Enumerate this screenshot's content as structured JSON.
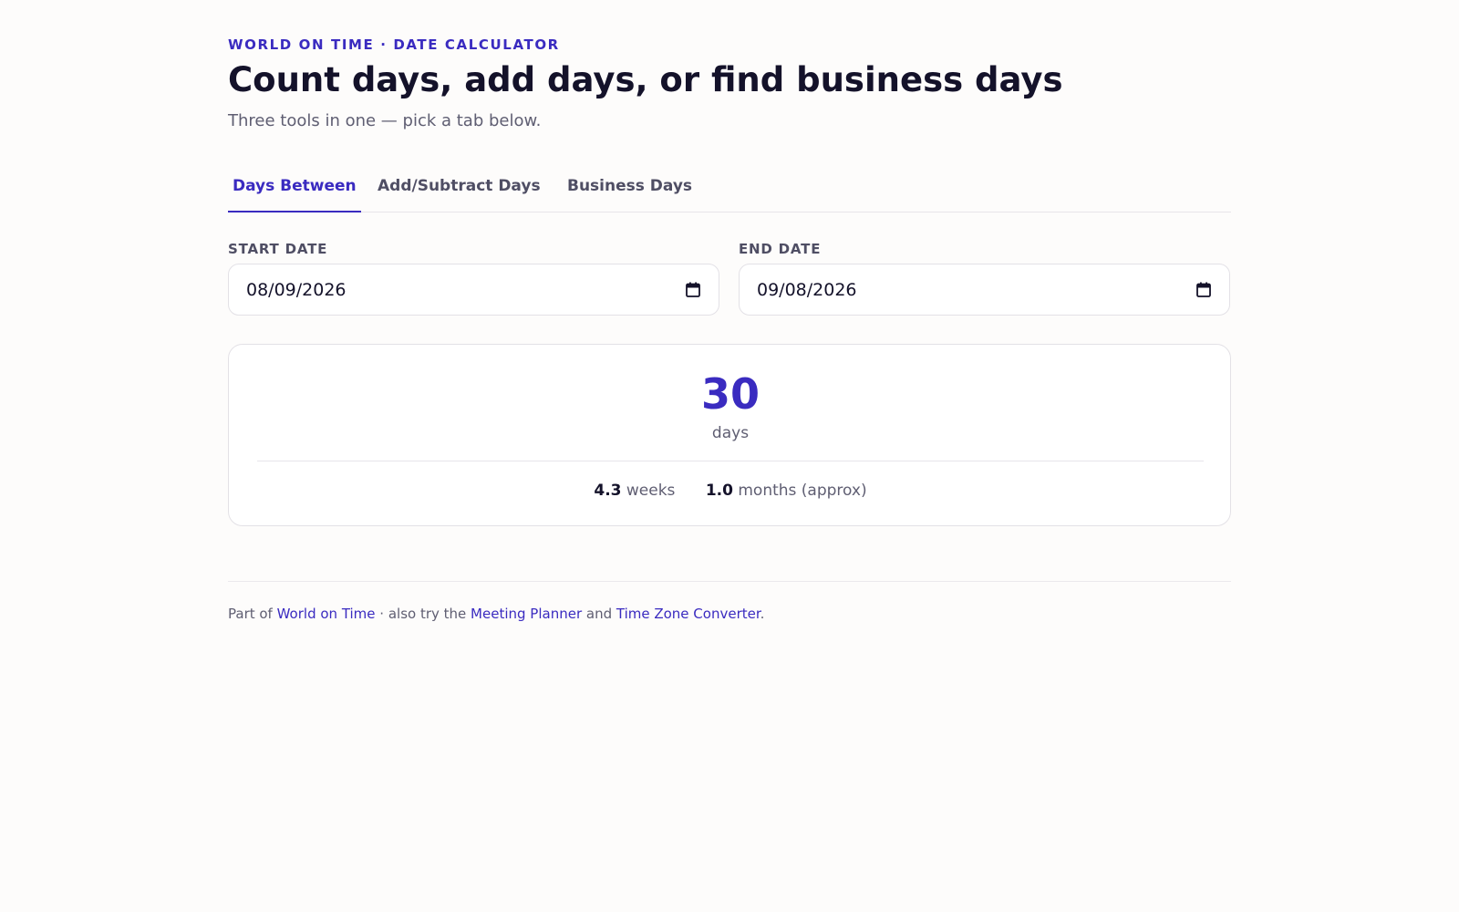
{
  "header": {
    "eyebrow": "WORLD ON TIME · DATE CALCULATOR",
    "title": "Count days, add days, or find business days",
    "subtitle": "Three tools in one — pick a tab below."
  },
  "tabs": [
    {
      "label": "Days Between",
      "active": true
    },
    {
      "label": "Add/Subtract Days",
      "active": false
    },
    {
      "label": "Business Days",
      "active": false
    }
  ],
  "form": {
    "start_label": "START DATE",
    "start_value": "08/09/2026",
    "end_label": "END DATE",
    "end_value": "09/08/2026"
  },
  "result": {
    "value": "30",
    "unit": "days",
    "weeks_value": "4.3",
    "weeks_label": "weeks",
    "months_value": "1.0",
    "months_label": "months (approx)"
  },
  "footer": {
    "text_1": "Part of ",
    "link_1": "World on Time",
    "text_2": " · also try the ",
    "link_2": "Meeting Planner",
    "text_3": " and ",
    "link_3": "Time Zone Converter",
    "text_4": "."
  },
  "colors": {
    "accent": "#3a2bc0",
    "text": "#14122a",
    "muted": "#5f5e72",
    "background": "#fdfcfb"
  },
  "icons": {
    "date_picker": "calendar-icon"
  }
}
